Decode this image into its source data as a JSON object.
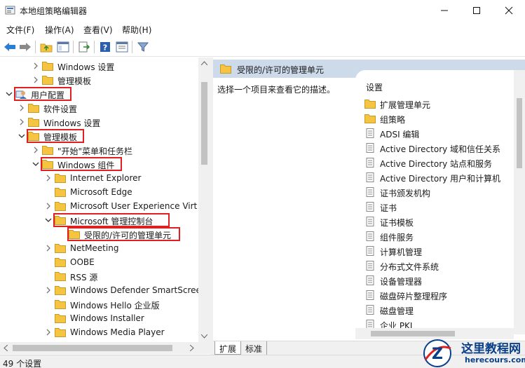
{
  "window": {
    "title": "本地组策略编辑器"
  },
  "menu": [
    "文件(F)",
    "操作(A)",
    "查看(V)",
    "帮助(H)"
  ],
  "tree": [
    {
      "label": "Windows 设置",
      "depth": 2,
      "arrow": "right"
    },
    {
      "label": "管理模板",
      "depth": 2,
      "arrow": "right"
    },
    {
      "label": "用户配置",
      "depth": 0,
      "arrow": "down",
      "icon": "user",
      "highlight": true
    },
    {
      "label": "软件设置",
      "depth": 1,
      "arrow": "right"
    },
    {
      "label": "Windows 设置",
      "depth": 1,
      "arrow": "right"
    },
    {
      "label": "管理模板",
      "depth": 1,
      "arrow": "down",
      "highlight": true
    },
    {
      "label": "\"开始\"菜单和任务栏",
      "depth": 2,
      "arrow": "right"
    },
    {
      "label": "Windows 组件",
      "depth": 2,
      "arrow": "down",
      "highlight": true
    },
    {
      "label": "Internet Explorer",
      "depth": 3,
      "arrow": "right"
    },
    {
      "label": "Microsoft Edge",
      "depth": 3,
      "arrow": "none"
    },
    {
      "label": "Microsoft User Experience Virt",
      "depth": 3,
      "arrow": "right"
    },
    {
      "label": "Microsoft 管理控制台",
      "depth": 3,
      "arrow": "down",
      "highlight": true
    },
    {
      "label": "受限的/许可的管理单元",
      "depth": 4,
      "arrow": "none",
      "highlight": true,
      "selected": true
    },
    {
      "label": "NetMeeting",
      "depth": 3,
      "arrow": "right"
    },
    {
      "label": "OOBE",
      "depth": 3,
      "arrow": "none"
    },
    {
      "label": "RSS 源",
      "depth": 3,
      "arrow": "none"
    },
    {
      "label": "Windows Defender SmartScree",
      "depth": 3,
      "arrow": "right"
    },
    {
      "label": "Windows Hello 企业版",
      "depth": 3,
      "arrow": "none"
    },
    {
      "label": "Windows Installer",
      "depth": 3,
      "arrow": "none"
    },
    {
      "label": "Windows Media Player",
      "depth": 3,
      "arrow": "right"
    }
  ],
  "right": {
    "header": "受限的/许可的管理单元",
    "description": "选择一个项目来查看它的描述。",
    "list_header": "设置",
    "items": [
      {
        "label": "扩展管理单元",
        "icon": "folder"
      },
      {
        "label": "组策略",
        "icon": "folder"
      },
      {
        "label": "ADSI 编辑",
        "icon": "policy"
      },
      {
        "label": "Active Directory 域和信任关系",
        "icon": "policy"
      },
      {
        "label": "Active Directory 站点和服务",
        "icon": "policy"
      },
      {
        "label": "Active Directory 用户和计算机",
        "icon": "policy"
      },
      {
        "label": "证书颁发机构",
        "icon": "policy"
      },
      {
        "label": "证书",
        "icon": "policy"
      },
      {
        "label": "证书模板",
        "icon": "policy"
      },
      {
        "label": "组件服务",
        "icon": "policy"
      },
      {
        "label": "计算机管理",
        "icon": "policy"
      },
      {
        "label": "分布式文件系统",
        "icon": "policy"
      },
      {
        "label": "设备管理器",
        "icon": "policy"
      },
      {
        "label": "磁盘碎片整理程序",
        "icon": "policy"
      },
      {
        "label": "磁盘管理",
        "icon": "policy"
      },
      {
        "label": "企业 PKI",
        "icon": "policy"
      }
    ]
  },
  "tabs": [
    "扩展",
    "标准"
  ],
  "status": "49 个设置",
  "watermark": {
    "title": "这里教程网",
    "url": "herecours.com",
    "letter": "Z"
  },
  "colors": {
    "highlight": "#e02020",
    "header_bg": "#ccdaea",
    "folder": "#f5c542",
    "watermark": "#0a3f8a"
  }
}
